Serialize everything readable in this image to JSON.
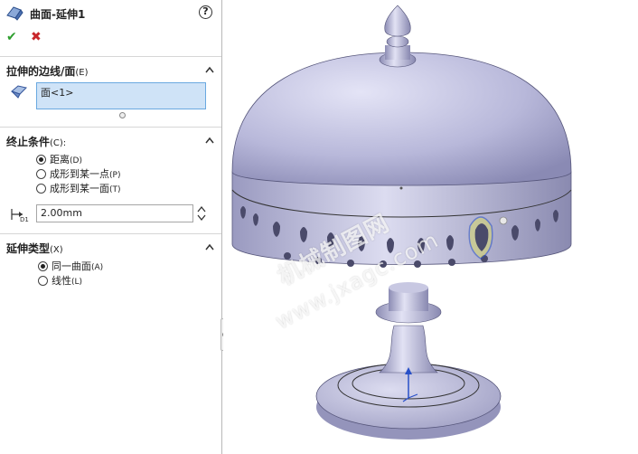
{
  "feature": {
    "title": "曲面-延伸1",
    "help_label": "?",
    "ok_icon": "checkmark-icon",
    "cancel_icon": "close-icon"
  },
  "edges_section": {
    "title": "拉伸的边线/面",
    "hotkey": "(E)",
    "selection": "面<1>"
  },
  "end_condition": {
    "title": "终止条件",
    "hotkey": "(C):",
    "options": [
      {
        "label": "距离",
        "hotkey": "(D)",
        "selected": true
      },
      {
        "label": "成形到某一点",
        "hotkey": "(P)",
        "selected": false
      },
      {
        "label": "成形到某一面",
        "hotkey": "(T)",
        "selected": false
      }
    ],
    "distance_value": "2.00mm"
  },
  "extension_type": {
    "title": "延伸类型",
    "hotkey": "(X)",
    "options": [
      {
        "label": "同一曲面",
        "hotkey": "(A)",
        "selected": true
      },
      {
        "label": "线性",
        "hotkey": "(L)",
        "selected": false
      }
    ]
  },
  "watermark": {
    "line1": "机械制图网",
    "line2": "www.jxagc.com"
  },
  "colors": {
    "model_fill": "#c8c8e6",
    "selection_highlight": "#d8d86a",
    "accent_blue": "#2850c8"
  }
}
